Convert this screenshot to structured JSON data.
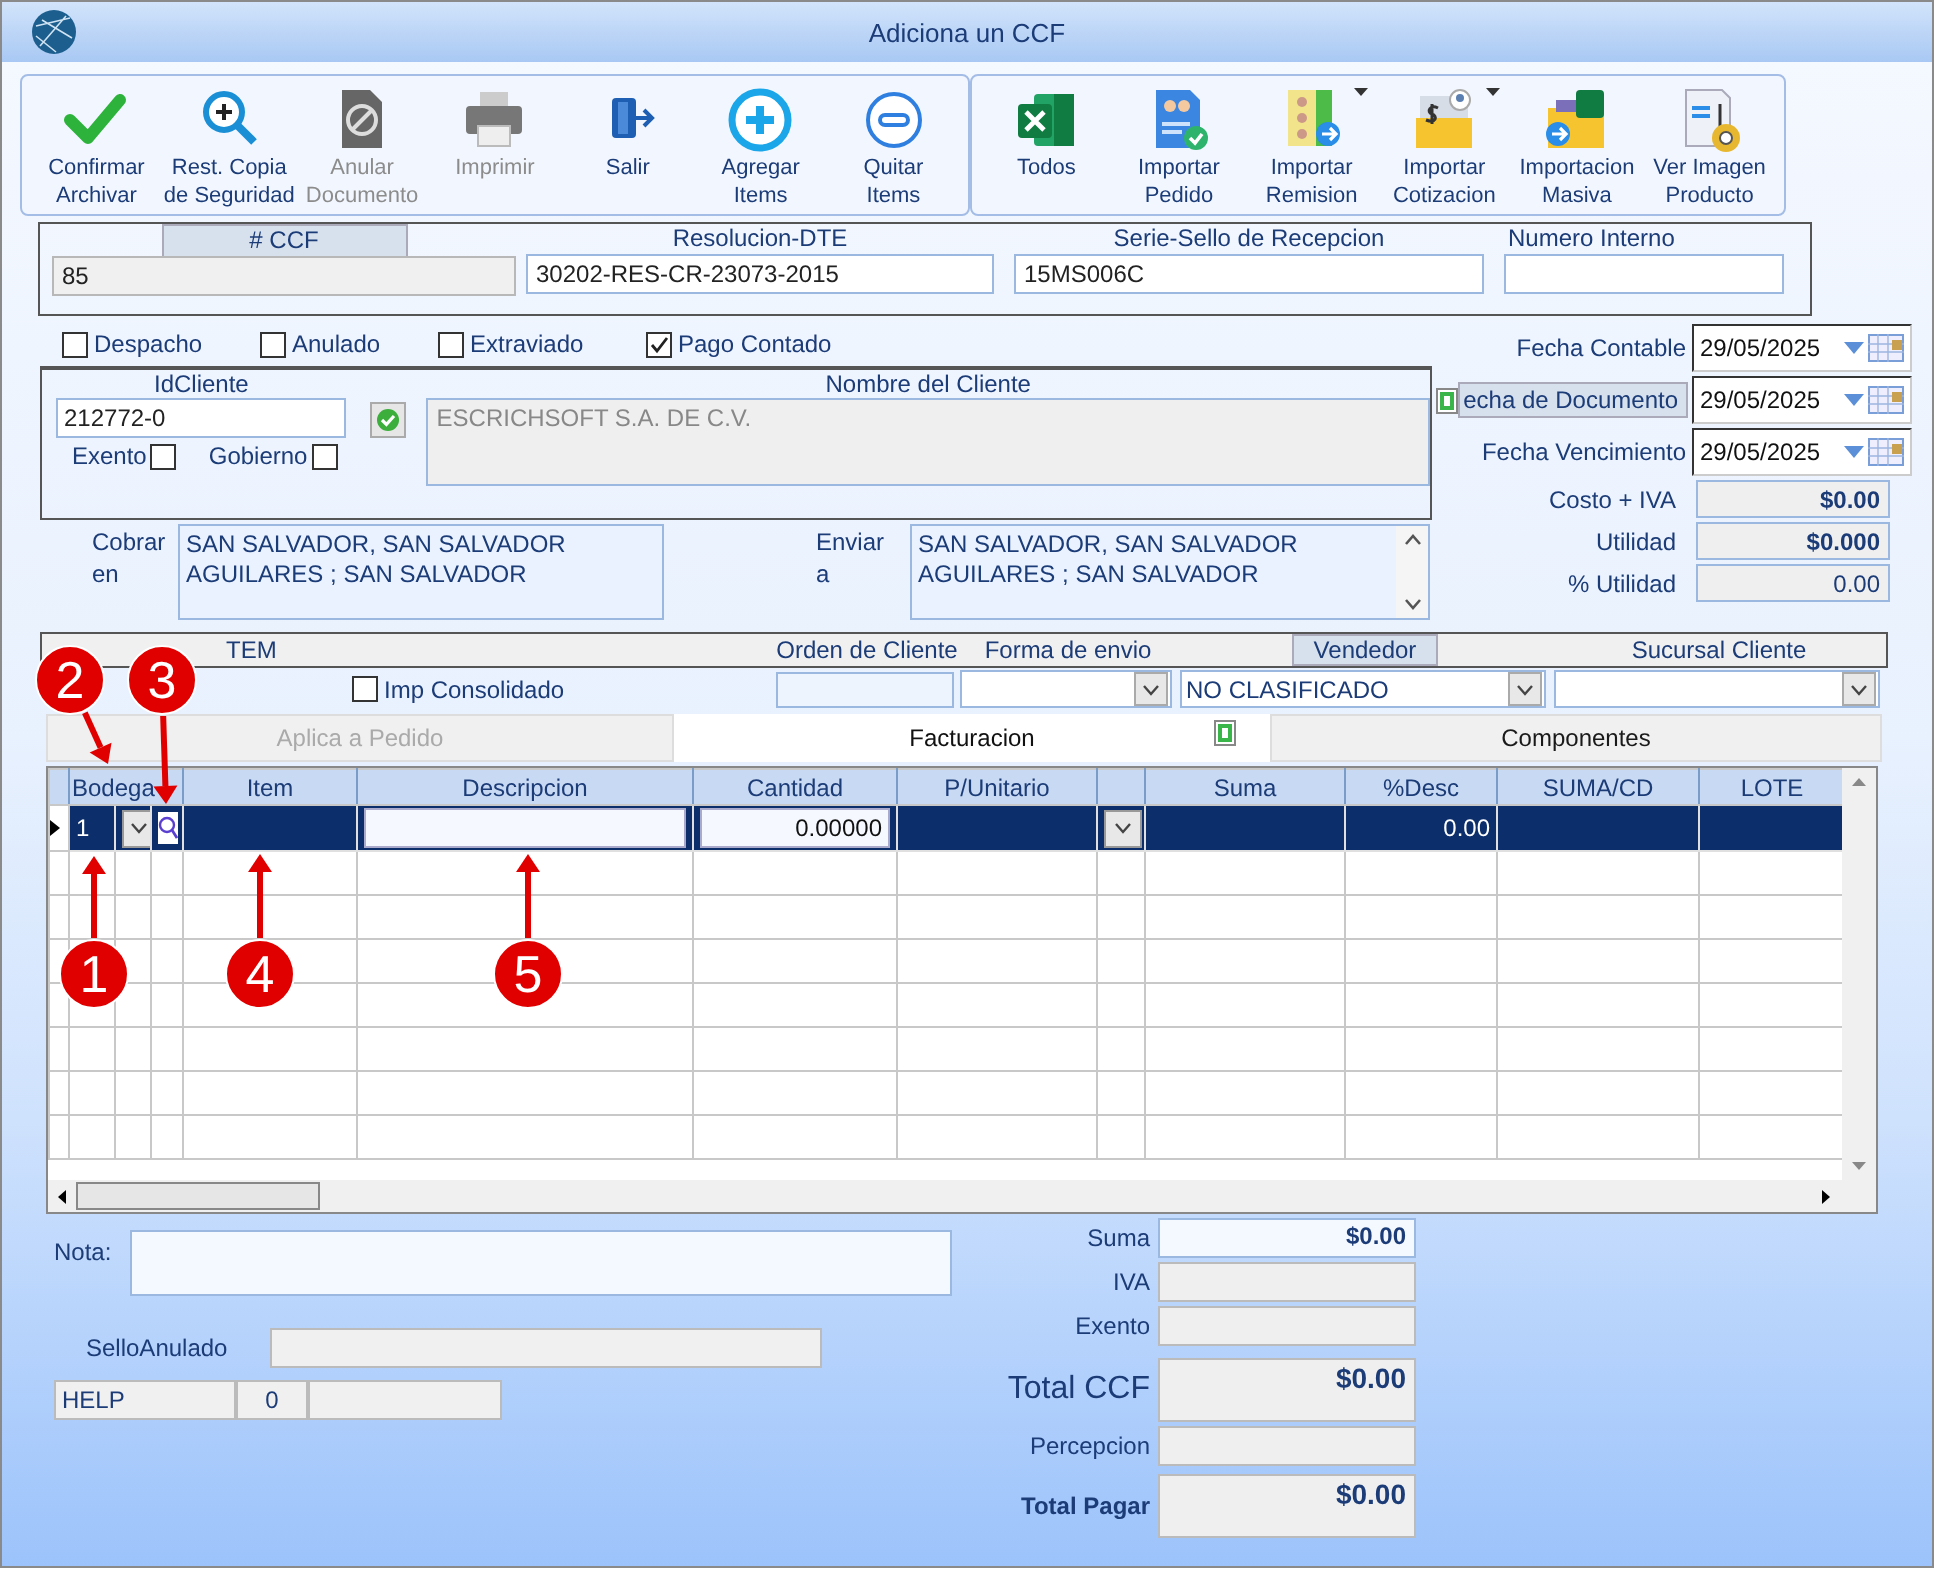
{
  "window": {
    "title": "Adiciona un CCF"
  },
  "toolbar_groups": [
    [
      {
        "lines": [
          "Confirmar",
          "Archivar"
        ],
        "disabled": false,
        "has_menu": false
      },
      {
        "lines": [
          "Rest. Copia",
          "de Seguridad"
        ],
        "disabled": false,
        "has_menu": false
      },
      {
        "lines": [
          "Anular",
          "Documento"
        ],
        "disabled": true,
        "has_menu": false
      },
      {
        "lines": [
          "Imprimir"
        ],
        "disabled": true,
        "has_menu": false
      },
      {
        "lines": [
          "Salir"
        ],
        "disabled": false,
        "has_menu": false
      },
      {
        "lines": [
          "Agregar",
          "Items"
        ],
        "disabled": false,
        "has_menu": false
      },
      {
        "lines": [
          "Quitar",
          "Items"
        ],
        "disabled": false,
        "has_menu": false
      }
    ],
    [
      {
        "lines": [
          "Todos"
        ],
        "disabled": false,
        "has_menu": false
      },
      {
        "lines": [
          "Importar",
          "Pedido"
        ],
        "disabled": false,
        "has_menu": false
      },
      {
        "lines": [
          "Importar",
          "Remision"
        ],
        "disabled": false,
        "has_menu": true
      },
      {
        "lines": [
          "Importar",
          "Cotizacion"
        ],
        "disabled": false,
        "has_menu": true
      },
      {
        "lines": [
          "Importacion",
          "Masiva"
        ],
        "disabled": false,
        "has_menu": false
      },
      {
        "lines": [
          "Ver Imagen",
          "Producto"
        ],
        "disabled": false,
        "has_menu": false
      }
    ]
  ],
  "header_fields": [
    {
      "label": "# CCF",
      "value": "85",
      "kind": "tab"
    },
    {
      "label": "Resolucion-DTE",
      "value": "30202-RES-CR-23073-2015",
      "kind": "plain"
    },
    {
      "label": "Serie-Sello de Recepcion",
      "value": "15MS006C",
      "kind": "plain"
    },
    {
      "label": "Numero Interno",
      "kind": "plain"
    }
  ],
  "flags": [
    {
      "label": "Despacho",
      "checked": false
    },
    {
      "label": "Anulado",
      "checked": false
    },
    {
      "label": "Extraviado",
      "checked": false
    },
    {
      "label": "Pago Contado",
      "checked": true
    }
  ],
  "client": {
    "id_label": "IdCliente",
    "id_value": "212772-0",
    "exento": {
      "label": "Exento",
      "checked": false
    },
    "gobierno": {
      "label": "Gobierno",
      "checked": false
    },
    "name_label": "Nombre del Cliente",
    "name_value": "ESCRICHSOFT S.A. DE C.V."
  },
  "addresses": [
    {
      "label": "Cobrar en",
      "lines": [
        "SAN SALVADOR, SAN SALVADOR",
        "AGUILARES ; SAN SALVADOR"
      ],
      "scrollbar": false
    },
    {
      "label": "Enviar a",
      "lines": [
        "SAN SALVADOR, SAN SALVADOR",
        "AGUILARES ; SAN SALVADOR"
      ],
      "scrollbar": true
    }
  ],
  "dates": [
    {
      "label": "Fecha Contable",
      "value": "29/05/2025",
      "kind": "plain"
    },
    {
      "label": "echa de  Documento",
      "value": "29/05/2025",
      "kind": "tab"
    },
    {
      "label": "Fecha Vencimiento",
      "value": "29/05/2025",
      "kind": "plain"
    }
  ],
  "costs": [
    {
      "label": "Costo + IVA",
      "value": "$0.00",
      "bold": true
    },
    {
      "label": "Utilidad",
      "value": "$0.000",
      "bold": true
    },
    {
      "label": "% Utilidad",
      "value": "0.00",
      "bold": false
    }
  ],
  "items_bar": {
    "title": "TEM",
    "imp_consolidado": {
      "label": "Imp Consolidado",
      "checked": false
    },
    "fields": [
      {
        "label": "Orden de Cliente",
        "kind": "text",
        "tab": false
      },
      {
        "label": "Forma de envio",
        "kind": "select",
        "tab": false
      },
      {
        "label": "Vendedor",
        "kind": "select",
        "value": "NO CLASIFICADO",
        "tab": true
      },
      {
        "label": "Sucursal Cliente",
        "kind": "select",
        "tab": false
      }
    ]
  },
  "tabs": [
    {
      "label": "Aplica a Pedido",
      "selected": false,
      "disabled": true
    },
    {
      "label": "Facturacion",
      "selected": true,
      "disabled": false
    },
    {
      "label": "Componentes",
      "selected": false,
      "disabled": false
    }
  ],
  "table": {
    "columns": [
      "Bodega",
      "Item",
      "Descripcion",
      "Cantidad",
      "P/Unitario",
      "",
      "Suma",
      "%Desc",
      "SUMA/CD",
      "LOTE"
    ],
    "rows": [
      {
        "selected": true,
        "cells": [
          "1",
          "",
          "",
          "0.00000",
          "",
          "",
          "",
          "0.00",
          "",
          ""
        ]
      }
    ]
  },
  "nota": {
    "label": "Nota:"
  },
  "sello": {
    "label": "SelloAnulado"
  },
  "help_cells": [
    "HELP",
    "0",
    ""
  ],
  "totals": [
    {
      "label": "Suma",
      "value": "$0.00",
      "kind": "plain"
    },
    {
      "label": "IVA",
      "kind": "plain"
    },
    {
      "label": "Exento",
      "kind": "plain"
    },
    {
      "label": "Total CCF",
      "value": "$0.00",
      "kind": "large"
    },
    {
      "label": "Percepcion",
      "kind": "plain"
    },
    {
      "label": "Total Pagar",
      "value": "$0.00",
      "kind": "strong"
    }
  ],
  "annotations": [
    "2",
    "3",
    "1",
    "4",
    "5"
  ]
}
